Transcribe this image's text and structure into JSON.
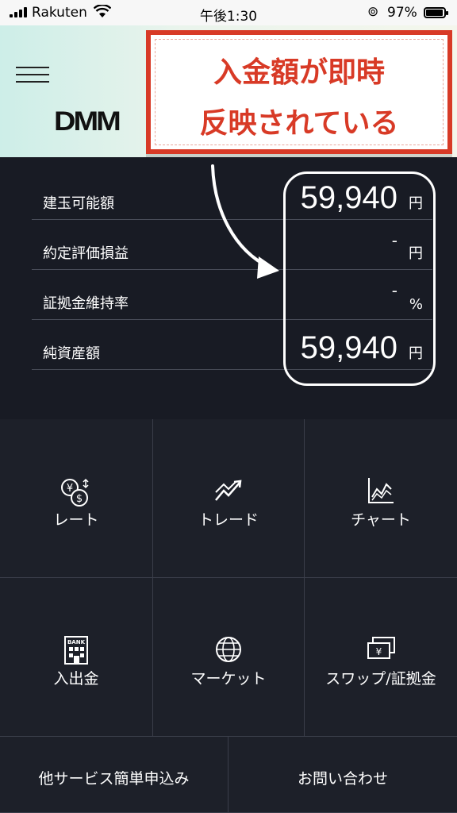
{
  "status_bar": {
    "carrier": "Rakuten",
    "time": "午後1:30",
    "battery": "97%",
    "battery_level": 0.97
  },
  "header": {
    "logo_text": "DMM",
    "callout_line1": "入金額が即時",
    "callout_line2": "反映されている"
  },
  "summary": {
    "rows": [
      {
        "label": "建玉可能額",
        "value": "59,940",
        "unit": "円"
      },
      {
        "label": "約定評価損益",
        "value": "-",
        "unit": "円"
      },
      {
        "label": "証拠金維持率",
        "value": "-",
        "unit": "%"
      },
      {
        "label": "純資産額",
        "value": "59,940",
        "unit": "円"
      }
    ]
  },
  "menu": {
    "items": [
      {
        "label": "レート",
        "icon": "yen-dollar-exchange-icon"
      },
      {
        "label": "トレード",
        "icon": "trade-chart-icon"
      },
      {
        "label": "チャート",
        "icon": "line-chart-icon"
      },
      {
        "label": "入出金",
        "icon": "bank-icon",
        "icon_text": "BANK"
      },
      {
        "label": "マーケット",
        "icon": "globe-icon"
      },
      {
        "label": "スワップ/証拠金",
        "icon": "yen-bills-icon"
      }
    ],
    "bottom": [
      {
        "label": "他サービス簡単申込み"
      },
      {
        "label": "お問い合わせ"
      }
    ]
  },
  "colors": {
    "background": "#1b1e27",
    "callout_red": "#d83a26",
    "divider": "#4a4e5a"
  }
}
